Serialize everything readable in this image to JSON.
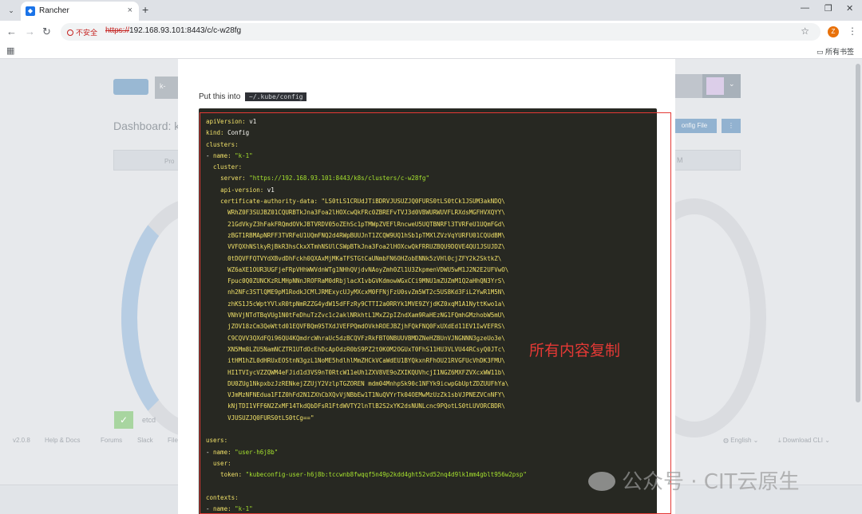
{
  "browser": {
    "tab_title": "Rancher",
    "tab_close": "×",
    "new_tab": "+",
    "insecure_label": "不安全",
    "url_scheme": "https://",
    "url_rest": "192.168.93.101:8443/c/c-w28fg",
    "profile_initial": "Z",
    "bookmarks_all": "所有书签"
  },
  "rancher": {
    "cluster_abbr": "k-",
    "dashboard_title": "Dashboard: k",
    "kubeconfig_button": "onfig File",
    "more_button": "⋮",
    "strip_left": "Pro",
    "strip_right": "M",
    "etcd_label": "etcd",
    "footer": {
      "version": "v2.0.8",
      "help": "Help & Docs",
      "forums": "Forums",
      "slack": "Slack",
      "file": "File",
      "language": "English",
      "download": "Download CLI"
    }
  },
  "modal": {
    "instruction": "Put this into",
    "path": "~/.kube/config",
    "annotation": "所有内容复制"
  },
  "kubeconfig": {
    "apiVersion": "v1",
    "kind": "Config",
    "cluster_name": "\"k-1\"",
    "server": "\"https://192.168.93.101:8443/k8s/clusters/c-w28fg\"",
    "api_version": "v1",
    "ca_lines": [
      "\"LS0tLS1CRUdJTiBDRVJUSUZJQ0FURS0tLS0tCk1JSUM3akNDQ\\",
      "WRhZ0F3SUJBZ01CQURBTkJna3Foa2lHOXcwQkFRc0ZBREFvTVJ3d0VBWURWUVFLRXdsMGFHVXQYY\\",
      "21GdVkyZ3hFakFRQmdOVkJBTVRDV05oZEhSc1pTMWpZVEFlRncweU5UQTBNRFl3TVRFeU1UQmFGd\\",
      "zBGT1RBMApNRFF3TVRFeU1UQmFNQ2d4RWpBUUJnT1ZCQW9UQ1hSb1pTMXlZVzVqYURFU01CQUdBM\\",
      "VVFQXhNSlkyRjBkR3hsCkxXTmhNSUlCSWpBTkJna3Foa2lHOXcwQkFRRUZBQU9DQVE4QU1JSUJDZ\\",
      "0tDQVFFQTVYdXBvdDhFckh0QXAxMjMKaTFSTGtCaUNmbFN6OHZobENNk5zVHl0cjZFY2k2SktkZ\\",
      "WZ6aXE1OUR3UGFjeFRpVHhWWVdnWTg1NHhQVjdvNAoyZmh0Zl1U3ZkpmenVDWU5wM1J2N2E2UFVwO\\",
      "Fpuc0Q0ZUNCKzRLMHpNNnJROFRaM0dRbjlacX1vbGVKdmowWGxCCi9MNU1mZUZmM1Q2aHhQN3YrS\\",
      "nh2NFc3STlQME9pM1RodkJCMlJRMExycUJyMXcxM0FFNjFzU0svZm5WT2c5US8Kd3FiL2YwR1M5N\\",
      "zhKS1J5cWptYVlxR0tpNmRZZG4ydW15dFFzRy9CTTI2a0RRYk1MVE9ZYjdKZ0xqM1A1NyttKwo1a\\",
      "VNhVjNTdTBqVUg1N0tFeDhuTzZvc1c2aklNRkhtL1MxZ2pIZndXam9RaHEzNG1FQmhGMzhobW5mU\\",
      "jZOV18zCm3QeWttd01EQVFBQm95TXdJVEFPQmdOVkhROEJBZjhFQkFNQ0FxUXdEd11EV1IwVEFRS\\",
      "C9CQVV3QXdFQi96QU4KQmdrcWhraUc5dzBCQVFzRkFBT0NBUUVBMDZNeHZBUnVJNGNNN3gzeUo3e\\",
      "XN5Mm8LZU5NamNCZTR1UTdOcEhDcApOdzR0bS9PZ2t0K0M2OGUxT0FhS11HU3VLVU44RCsyQ0JTc\\",
      "itHM1hZL0dHRUxEOStnN3gzL1NoME5hdlhlMmZHCkVCaWdEU1BYQkxnRFhOU21RVGFUcVhDK3FMU\\",
      "HI1TVIycVZZQWM4eFJid1d3VS9nT0RtcW11eUh1ZXV8VE9oZXIKQUVhcjI1NGZ6MXFZVXcxWW11b\\",
      "DU0ZUg1NkpxbzJzRENkejZZUjY2VzlpTGZOREN mdm04MnhpSk90c1NFYk9icwpGbUptZDZUUFhYa\\",
      "VJmMzNFNEdua1FIZ0hFd2N1ZXhCbXQvVjNBbEw1T1NuQVYrTk04OEMwMzUzZk1sbVJPNEZVCnNFY\\",
      "kNjTDI1VFF6N2ZxMF14TkdQbDFsR1FtdWVTY2lnTlB2S2xYK2dsNUNLcnc9PQotLS0tLUVORCBDR\\",
      "VJUSUZJQ0FURS0tLS0tCg==\""
    ],
    "user_name": "\"user-h6j8b\"",
    "token": "\"kubeconfig-user-h6j8b:tccwnb8fwqqf5n49p2kdd4ght52vd52nq4d9lk1mm4gblt956w2psp\"",
    "context_name": "\"k-1\""
  },
  "watermark": "公众号 · CIT云原生"
}
